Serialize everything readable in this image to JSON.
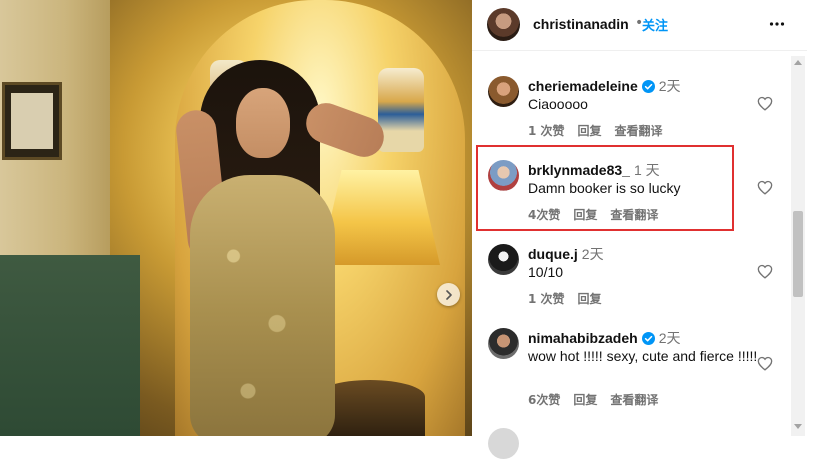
{
  "post": {
    "username": "christinanadin",
    "separator": "•",
    "follow_label": "关注",
    "more_icon": "more-horizontal-icon"
  },
  "comments": [
    {
      "username": "cheriemadeleine",
      "verified": true,
      "time": "2天",
      "text": "Ciaooooo",
      "likes": "1 次赞",
      "reply": "回复",
      "translate": "查看翻译"
    },
    {
      "username": "brklynmade83_",
      "verified": false,
      "time": "1 天",
      "text": "Damn booker is so lucky",
      "likes": "4次赞",
      "reply": "回复",
      "translate": "查看翻译",
      "highlighted": true
    },
    {
      "username": "duque.j",
      "verified": false,
      "time": "2天",
      "text": "10/10",
      "likes": "1 次赞",
      "reply": "回复"
    },
    {
      "username": "nimahabibzadeh",
      "verified": true,
      "time": "2天",
      "text": "wow hot !!!!! sexy, cute and fierce !!!!!",
      "likes": "6次赞",
      "reply": "回复",
      "translate": "查看翻译"
    }
  ],
  "colors": {
    "accent": "#0095f6",
    "verified": "#0095f6",
    "highlight": "#e03030",
    "muted": "#737373"
  }
}
